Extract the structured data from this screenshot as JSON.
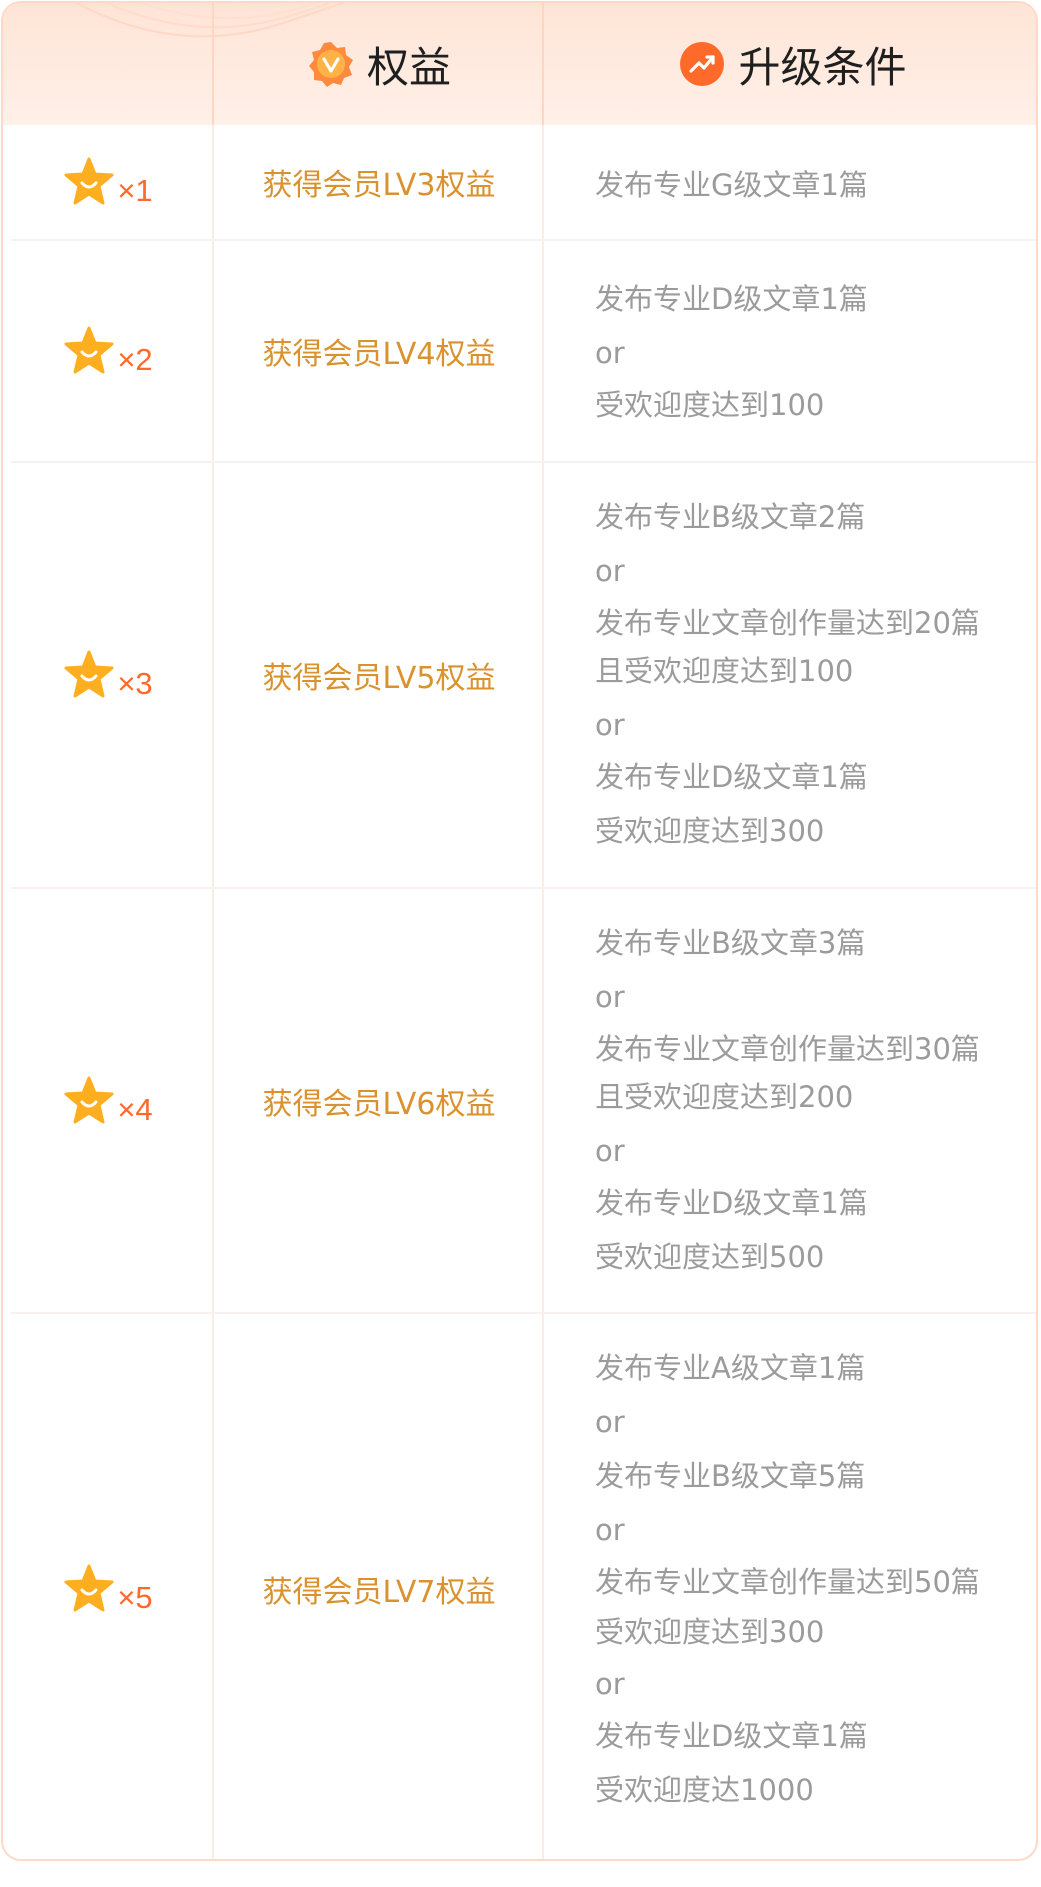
{
  "header": {
    "benefit_title": "权益",
    "condition_title": "升级条件"
  },
  "colors": {
    "header_bg": "#ffe4d6",
    "border": "#ffd8c8",
    "multiplier": "#ff6a2a",
    "benefit_text": "#d9922d",
    "condition_text": "#9b9b9b",
    "star": "#ffb020"
  },
  "rows": [
    {
      "multiplier": "×1",
      "benefit": "获得会员LV3权益",
      "conditions": [
        "发布专业G级文章1篇"
      ]
    },
    {
      "multiplier": "×2",
      "benefit": "获得会员LV4权益",
      "conditions": [
        "发布专业D级文章1篇",
        "or",
        "受欢迎度达到100"
      ]
    },
    {
      "multiplier": "×3",
      "benefit": "获得会员LV5权益",
      "conditions": [
        "发布专业B级文章2篇",
        "or",
        "发布专业文章创作量达到20篇",
        "且受欢迎度达到100",
        "or",
        "发布专业D级文章1篇",
        "受欢迎度达到300"
      ]
    },
    {
      "multiplier": "×4",
      "benefit": "获得会员LV6权益",
      "conditions": [
        "发布专业B级文章3篇",
        "or",
        "发布专业文章创作量达到30篇",
        "且受欢迎度达到200",
        "or",
        "发布专业D级文章1篇",
        "受欢迎度达到500"
      ]
    },
    {
      "multiplier": "×5",
      "benefit": "获得会员LV7权益",
      "conditions": [
        "发布专业A级文章1篇",
        "or",
        "发布专业B级文章5篇",
        "or",
        "发布专业文章创作量达到50篇",
        "受欢迎度达到300",
        "or",
        "发布专业D级文章1篇",
        "受欢迎度达1000"
      ]
    }
  ]
}
